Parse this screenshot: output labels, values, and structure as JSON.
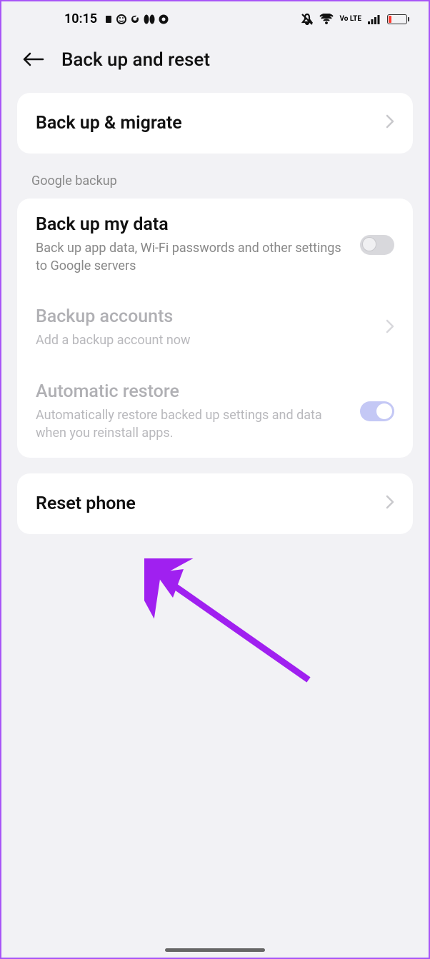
{
  "status": {
    "time": "10:15",
    "volte": "Vo LTE"
  },
  "header": {
    "title": "Back up and reset"
  },
  "backup_migrate": {
    "title": "Back up & migrate"
  },
  "section_google": "Google backup",
  "backup_data": {
    "title": "Back up my data",
    "subtitle": "Back up app data, Wi-Fi passwords and other settings to Google servers"
  },
  "backup_accounts": {
    "title": "Backup accounts",
    "subtitle": "Add a backup account now"
  },
  "auto_restore": {
    "title": "Automatic restore",
    "subtitle": "Automatically restore backed up settings and data when you reinstall apps."
  },
  "reset_phone": {
    "title": "Reset phone"
  }
}
